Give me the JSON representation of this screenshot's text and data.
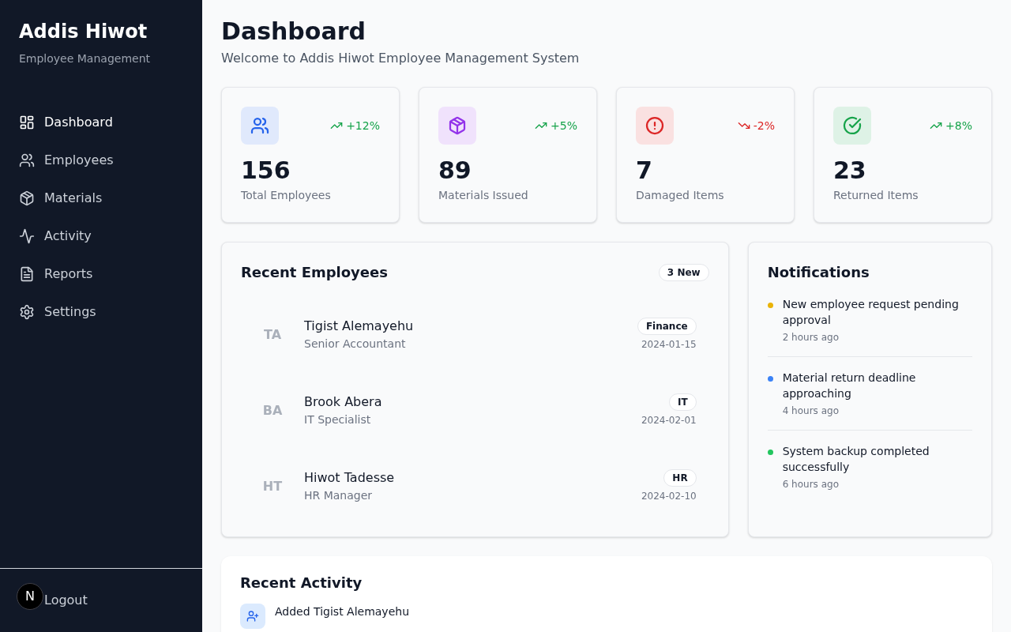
{
  "sidebar": {
    "title": "Addis Hiwot",
    "subtitle": "Employee Management",
    "nav": [
      {
        "label": "Dashboard",
        "selected": true
      },
      {
        "label": "Employees",
        "selected": false
      },
      {
        "label": "Materials",
        "selected": false
      },
      {
        "label": "Activity",
        "selected": false
      },
      {
        "label": "Reports",
        "selected": false
      },
      {
        "label": "Settings",
        "selected": false
      }
    ],
    "logout": {
      "label": "Logout"
    }
  },
  "overlay_badge": {
    "text": "N"
  },
  "header": {
    "title": "Dashboard",
    "subtitle": "Welcome to Addis Hiwot Employee Management System"
  },
  "stats": [
    {
      "value": "156",
      "label": "Total Employees",
      "color": "#2563eb",
      "trend": {
        "kind": "up",
        "text": "+12%"
      }
    },
    {
      "value": "89",
      "label": "Materials Issued",
      "color": "#9333ea",
      "trend": {
        "kind": "up",
        "text": "+5%"
      }
    },
    {
      "value": "7",
      "label": "Damaged Items",
      "color": "#dc2626",
      "trend": {
        "kind": "down",
        "text": "-2%"
      }
    },
    {
      "value": "23",
      "label": "Returned Items",
      "color": "#16a34a",
      "trend": {
        "kind": "up",
        "text": "+8%"
      }
    }
  ],
  "recent_employees": {
    "title": "Recent Employees",
    "badge": "3 New",
    "rows": [
      {
        "initials": "TA",
        "name": "Tigist Alemayehu",
        "role": "Senior Accountant",
        "department": "Finance",
        "date": "2024-01-15"
      },
      {
        "initials": "BA",
        "name": "Brook Abera",
        "role": "IT Specialist",
        "department": "IT",
        "date": "2024-02-01"
      },
      {
        "initials": "HT",
        "name": "Hiwot Tadesse",
        "role": "HR Manager",
        "department": "HR",
        "date": "2024-02-10"
      }
    ]
  },
  "notifications": {
    "title": "Notifications",
    "items": [
      {
        "text": "New employee request pending approval",
        "time": "2 hours ago",
        "color": "#eab308"
      },
      {
        "text": "Material return deadline approaching",
        "time": "4 hours ago",
        "color": "#3b82f6"
      },
      {
        "text": "System backup completed successfully",
        "time": "6 hours ago",
        "color": "#22c55e"
      }
    ]
  },
  "recent_activity": {
    "title": "Recent Activity",
    "items": [
      {
        "text": "Added Tigist Alemayehu"
      }
    ]
  }
}
